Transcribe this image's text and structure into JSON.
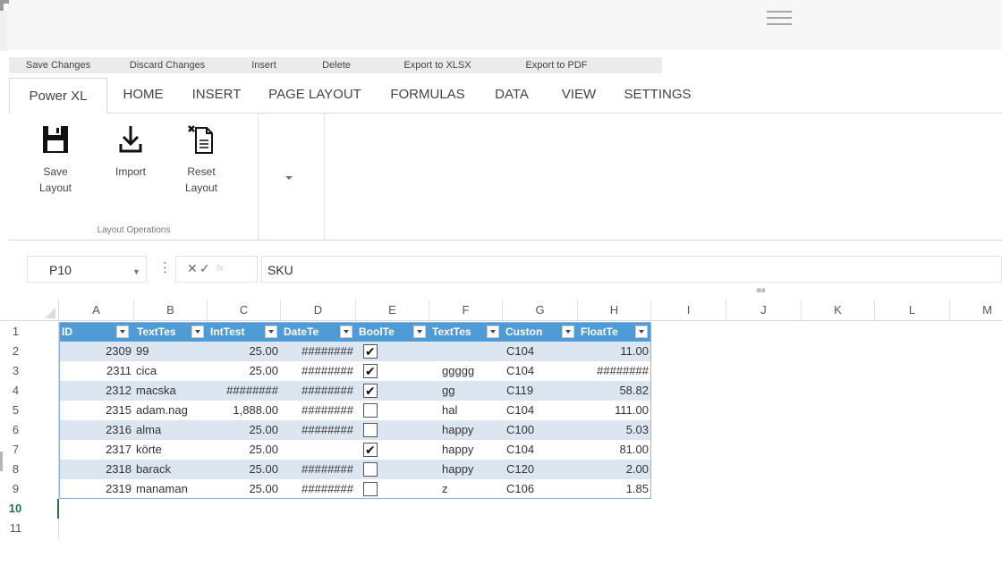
{
  "toolbar": {
    "items": [
      "Save Changes",
      "Discard Changes",
      "Insert",
      "Delete",
      "Export to XLSX",
      "Export to PDF"
    ]
  },
  "ribbon": {
    "tabs": [
      "Power XL",
      "HOME",
      "INSERT",
      "PAGE LAYOUT",
      "FORMULAS",
      "DATA",
      "VIEW",
      "SETTINGS"
    ],
    "active_tab": "Power XL",
    "group": {
      "label": "Layout Operations",
      "buttons": [
        {
          "label": "Save\nLayout",
          "icon": "floppy-disk-icon"
        },
        {
          "label": "Import",
          "icon": "download-icon"
        },
        {
          "label": "Reset\nLayout",
          "icon": "reset-document-icon"
        }
      ]
    }
  },
  "formula_bar": {
    "name_box": "P10",
    "cancel_glyph": "✕",
    "enter_glyph": "✓",
    "fx_label": "fx",
    "value": "SKU",
    "dots": "⋮"
  },
  "sheet": {
    "columns": [
      "A",
      "B",
      "C",
      "D",
      "E",
      "F",
      "G",
      "H",
      "I",
      "J",
      "K",
      "L",
      "M"
    ],
    "row_numbers": [
      "1",
      "2",
      "3",
      "4",
      "5",
      "6",
      "7",
      "8",
      "9",
      "10",
      "11"
    ],
    "selected_row": "10",
    "table_headers": [
      "ID",
      "TextTes",
      "IntTest",
      "DateTe",
      "BoolTe",
      "TextTes",
      "Custon",
      "FloatTe"
    ],
    "rows": [
      {
        "a": "2309",
        "b": "99",
        "c": "25.00",
        "d": "########",
        "e": true,
        "f": "",
        "g": "C104",
        "h": "11.00"
      },
      {
        "a": "2311",
        "b": "cica",
        "c": "25.00",
        "d": "########",
        "e": true,
        "f": "ggggg",
        "g": "C104",
        "h": "########"
      },
      {
        "a": "2312",
        "b": "macska",
        "c": "########",
        "d": "########",
        "e": true,
        "f": "gg",
        "g": "C119",
        "h": "58.82"
      },
      {
        "a": "2315",
        "b": "adam.nag",
        "c": "1,888.00",
        "d": "########",
        "e": false,
        "f": "hal",
        "g": "C104",
        "h": "111.00"
      },
      {
        "a": "2316",
        "b": "alma",
        "c": "25.00",
        "d": "########",
        "e": false,
        "f": "happy",
        "g": "C100",
        "h": "5.03"
      },
      {
        "a": "2317",
        "b": "körte",
        "c": "25.00",
        "d": "",
        "e": true,
        "f": "happy",
        "g": "C104",
        "h": "81.00"
      },
      {
        "a": "2318",
        "b": "barack",
        "c": "25.00",
        "d": "########",
        "e": false,
        "f": "happy",
        "g": "C120",
        "h": "2.00"
      },
      {
        "a": "2319",
        "b": "manaman",
        "c": "25.00",
        "d": "########",
        "e": false,
        "f": "z",
        "g": "C106",
        "h": "1.85"
      }
    ]
  },
  "colors": {
    "table_header": "#4f9bd6",
    "table_band": "#dce6f1",
    "selected_row_header": "#217346"
  }
}
